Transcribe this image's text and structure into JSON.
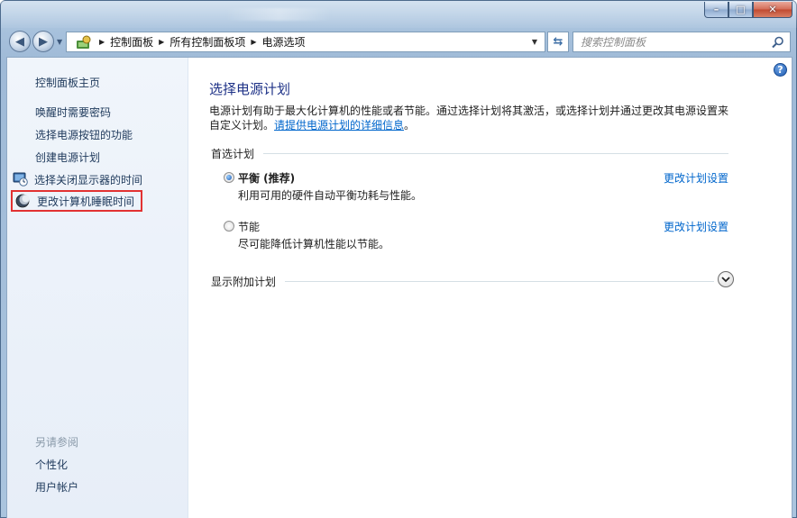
{
  "window": {
    "minimize_glyph": "–",
    "maximize_glyph": "□",
    "close_glyph": "✕"
  },
  "nav": {
    "back_glyph": "◀",
    "forward_glyph": "▶",
    "breadcrumb": [
      "控制面板",
      "所有控制面板项",
      "电源选项"
    ],
    "refresh_glyph": "⇆",
    "search_placeholder": "搜索控制面板"
  },
  "sidebar": {
    "home": "控制面板主页",
    "items": [
      {
        "label": "唤醒时需要密码"
      },
      {
        "label": "选择电源按钮的功能"
      },
      {
        "label": "创建电源计划"
      },
      {
        "label": "选择关闭显示器的时间"
      },
      {
        "label": "更改计算机睡眠时间"
      }
    ],
    "see_also": "另请参阅",
    "see_also_items": [
      {
        "label": "个性化"
      },
      {
        "label": "用户帐户"
      }
    ]
  },
  "main": {
    "help_glyph": "?",
    "title": "选择电源计划",
    "description": "电源计划有助于最大化计算机的性能或者节能。通过选择计划将其激活，或选择计划并通过更改其电源设置来自定义计划。",
    "description_link": "请提供电源计划的详细信息",
    "description_end": "。",
    "preferred_header": "首选计划",
    "plans": [
      {
        "name": "平衡 (推荐)",
        "desc": "利用可用的硬件自动平衡功耗与性能。",
        "link": "更改计划设置",
        "selected": true
      },
      {
        "name": "节能",
        "desc": "尽可能降低计算机性能以节能。",
        "link": "更改计划设置",
        "selected": false
      }
    ],
    "additional_header": "显示附加计划"
  },
  "colors": {
    "link": "#0066cc",
    "title": "#1e3287",
    "highlight": "#e23232"
  }
}
